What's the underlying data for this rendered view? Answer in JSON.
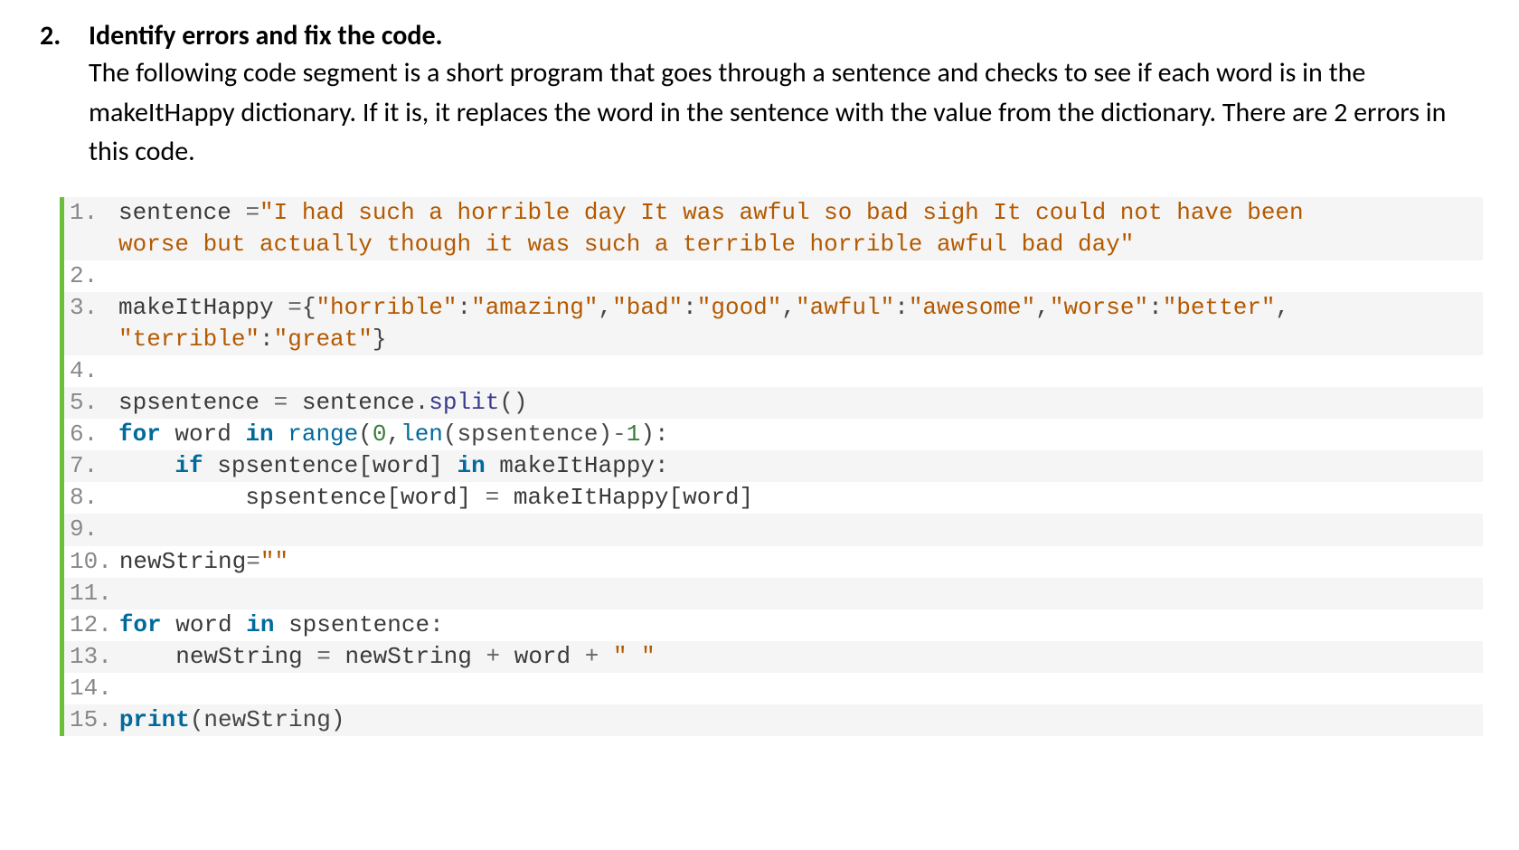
{
  "question": {
    "number": "2.",
    "title": "Identify errors and fix the code.",
    "body": "The following code segment is a short program that goes through a sentence and checks to see if each word is in the makeItHappy dictionary. If it is, it replaces the word in the sentence with the value from the dictionary. There are 2 errors in this code."
  },
  "code": {
    "lines": [
      {
        "n": "1.",
        "stripe": "odd",
        "tokens": [
          {
            "t": "sentence ",
            "c": "tok-name"
          },
          {
            "t": "=",
            "c": "tok-op"
          },
          {
            "t": "\"I had such a horrible day It was awful so bad sigh It could not have been ",
            "c": "tok-str"
          }
        ]
      },
      {
        "continuation": true,
        "stripe": "odd",
        "tokens": [
          {
            "t": "worse but actually though it was such a terrible horrible awful bad day\"",
            "c": "tok-str"
          }
        ]
      },
      {
        "n": "2.",
        "stripe": "even",
        "tokens": [
          {
            "t": " ",
            "c": "tok-name"
          }
        ]
      },
      {
        "n": "3.",
        "stripe": "odd",
        "tokens": [
          {
            "t": "makeItHappy ",
            "c": "tok-name"
          },
          {
            "t": "=",
            "c": "tok-op"
          },
          {
            "t": "{",
            "c": "tok-punc"
          },
          {
            "t": "\"horrible\"",
            "c": "tok-str"
          },
          {
            "t": ":",
            "c": "tok-punc"
          },
          {
            "t": "\"amazing\"",
            "c": "tok-str"
          },
          {
            "t": ",",
            "c": "tok-punc"
          },
          {
            "t": "\"bad\"",
            "c": "tok-str"
          },
          {
            "t": ":",
            "c": "tok-punc"
          },
          {
            "t": "\"good\"",
            "c": "tok-str"
          },
          {
            "t": ",",
            "c": "tok-punc"
          },
          {
            "t": "\"awful\"",
            "c": "tok-str"
          },
          {
            "t": ":",
            "c": "tok-punc"
          },
          {
            "t": "\"awesome\"",
            "c": "tok-str"
          },
          {
            "t": ",",
            "c": "tok-punc"
          },
          {
            "t": "\"worse\"",
            "c": "tok-str"
          },
          {
            "t": ":",
            "c": "tok-punc"
          },
          {
            "t": "\"better\"",
            "c": "tok-str"
          },
          {
            "t": ",",
            "c": "tok-punc"
          }
        ]
      },
      {
        "continuation": true,
        "stripe": "odd",
        "tokens": [
          {
            "t": "\"terrible\"",
            "c": "tok-str"
          },
          {
            "t": ":",
            "c": "tok-punc"
          },
          {
            "t": "\"great\"",
            "c": "tok-str"
          },
          {
            "t": "}",
            "c": "tok-punc"
          }
        ]
      },
      {
        "n": "4.",
        "stripe": "even",
        "tokens": [
          {
            "t": " ",
            "c": "tok-name"
          }
        ]
      },
      {
        "n": "5.",
        "stripe": "odd",
        "tokens": [
          {
            "t": "spsentence ",
            "c": "tok-name"
          },
          {
            "t": "= ",
            "c": "tok-op"
          },
          {
            "t": "sentence",
            "c": "tok-name"
          },
          {
            "t": ".",
            "c": "tok-punc"
          },
          {
            "t": "split",
            "c": "tok-func"
          },
          {
            "t": "()",
            "c": "tok-punc"
          }
        ]
      },
      {
        "n": "6.",
        "stripe": "even",
        "tokens": [
          {
            "t": "for ",
            "c": "tok-kw"
          },
          {
            "t": "word ",
            "c": "tok-name"
          },
          {
            "t": "in ",
            "c": "tok-kw"
          },
          {
            "t": "range",
            "c": "tok-bkw"
          },
          {
            "t": "(",
            "c": "tok-punc"
          },
          {
            "t": "0",
            "c": "tok-num"
          },
          {
            "t": ",",
            "c": "tok-punc"
          },
          {
            "t": "len",
            "c": "tok-bkw"
          },
          {
            "t": "(spsentence)",
            "c": "tok-punc"
          },
          {
            "t": "-",
            "c": "tok-op"
          },
          {
            "t": "1",
            "c": "tok-num"
          },
          {
            "t": "):",
            "c": "tok-punc"
          }
        ]
      },
      {
        "n": "7.",
        "stripe": "odd",
        "tokens": [
          {
            "t": "    ",
            "c": "tok-name"
          },
          {
            "t": "if ",
            "c": "tok-kw"
          },
          {
            "t": "spsentence[word] ",
            "c": "tok-name"
          },
          {
            "t": "in ",
            "c": "tok-kw"
          },
          {
            "t": "makeItHappy",
            "c": "tok-name"
          },
          {
            "t": ":",
            "c": "tok-punc"
          }
        ]
      },
      {
        "n": "8.",
        "stripe": "even",
        "tokens": [
          {
            "t": "         spsentence[word] ",
            "c": "tok-name"
          },
          {
            "t": "= ",
            "c": "tok-op"
          },
          {
            "t": "makeItHappy[word]",
            "c": "tok-name"
          }
        ]
      },
      {
        "n": "9.",
        "stripe": "odd",
        "tokens": [
          {
            "t": " ",
            "c": "tok-name"
          }
        ]
      },
      {
        "n": "10.",
        "stripe": "even",
        "tokens": [
          {
            "t": "newString",
            "c": "tok-name"
          },
          {
            "t": "=",
            "c": "tok-op"
          },
          {
            "t": "\"\"",
            "c": "tok-str"
          }
        ]
      },
      {
        "n": "11.",
        "stripe": "odd",
        "tokens": [
          {
            "t": " ",
            "c": "tok-name"
          }
        ]
      },
      {
        "n": "12.",
        "stripe": "even",
        "tokens": [
          {
            "t": "for ",
            "c": "tok-kw"
          },
          {
            "t": "word ",
            "c": "tok-name"
          },
          {
            "t": "in ",
            "c": "tok-kw"
          },
          {
            "t": "spsentence",
            "c": "tok-name"
          },
          {
            "t": ":",
            "c": "tok-punc"
          }
        ]
      },
      {
        "n": "13.",
        "stripe": "odd",
        "tokens": [
          {
            "t": "    newString ",
            "c": "tok-name"
          },
          {
            "t": "= ",
            "c": "tok-op"
          },
          {
            "t": "newString ",
            "c": "tok-name"
          },
          {
            "t": "+ ",
            "c": "tok-op"
          },
          {
            "t": "word ",
            "c": "tok-name"
          },
          {
            "t": "+ ",
            "c": "tok-op"
          },
          {
            "t": "\" \"",
            "c": "tok-str"
          }
        ]
      },
      {
        "n": "14.",
        "stripe": "even",
        "tokens": [
          {
            "t": " ",
            "c": "tok-name"
          }
        ]
      },
      {
        "n": "15.",
        "stripe": "odd",
        "tokens": [
          {
            "t": "print",
            "c": "tok-kw"
          },
          {
            "t": "(newString)",
            "c": "tok-punc"
          }
        ]
      }
    ]
  }
}
